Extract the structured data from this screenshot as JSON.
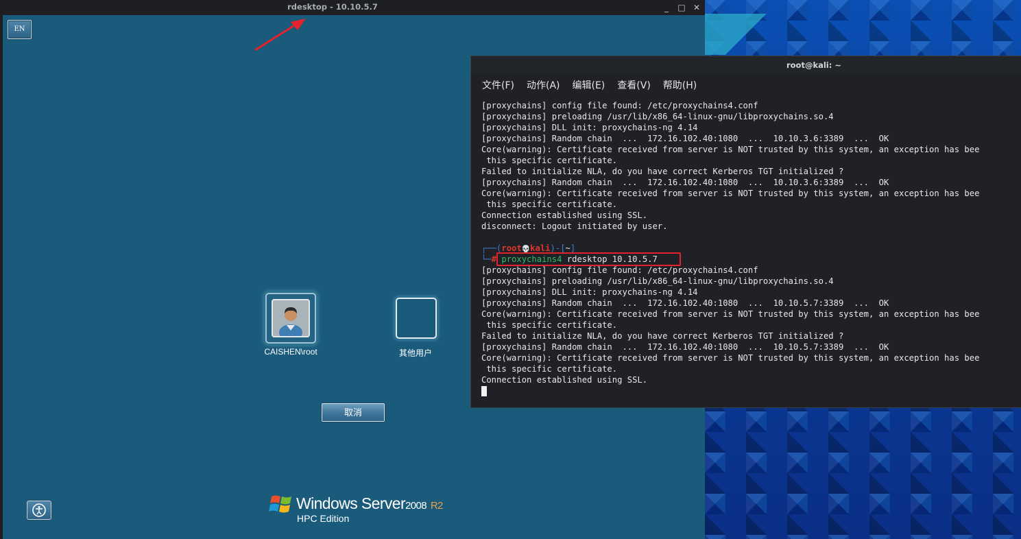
{
  "rdesktop": {
    "title": "rdesktop - 10.10.5.7",
    "controls": {
      "minimize": "_",
      "maximize": "□",
      "close": "✕"
    },
    "screen": {
      "language_badge": "EN",
      "users": [
        {
          "label": "CAISHEN\\root"
        },
        {
          "label": "其他用户"
        }
      ],
      "cancel_label": "取消",
      "branding": {
        "name": "Windows Server",
        "version": "2008",
        "release": "R2",
        "edition": "HPC Edition"
      }
    }
  },
  "terminal": {
    "title": "root@kali: ~",
    "menu": [
      "文件(F)",
      "动作(A)",
      "编辑(E)",
      "查看(V)",
      "帮助(H)"
    ],
    "lines_before": [
      "[proxychains] config file found: /etc/proxychains4.conf",
      "[proxychains] preloading /usr/lib/x86_64-linux-gnu/libproxychains.so.4",
      "[proxychains] DLL init: proxychains-ng 4.14",
      "[proxychains] Random chain  ...  172.16.102.40:1080  ...  10.10.3.6:3389  ...  OK",
      "Core(warning): Certificate received from server is NOT trusted by this system, an exception has bee",
      " this specific certificate.",
      "Failed to initialize NLA, do you have correct Kerberos TGT initialized ?",
      "[proxychains] Random chain  ...  172.16.102.40:1080  ...  10.10.3.6:3389  ...  OK",
      "Core(warning): Certificate received from server is NOT trusted by this system, an exception has bee",
      " this specific certificate.",
      "Connection established using SSL.",
      "disconnect: Logout initiated by user.",
      ""
    ],
    "prompt": {
      "frame_top": "┌──(",
      "user": "root",
      "skull": "💀",
      "host": "kali",
      "dir_open": ")-[",
      "dir": "~",
      "dir_close": "]",
      "frame_bottom": "└─",
      "symbol": "#",
      "command_name": "proxychains4",
      "command_args": " rdesktop 10.10.5.7"
    },
    "lines_after": [
      "[proxychains] config file found: /etc/proxychains4.conf",
      "[proxychains] preloading /usr/lib/x86_64-linux-gnu/libproxychains.so.4",
      "[proxychains] DLL init: proxychains-ng 4.14",
      "[proxychains] Random chain  ...  172.16.102.40:1080  ...  10.10.5.7:3389  ...  OK",
      "Core(warning): Certificate received from server is NOT trusted by this system, an exception has bee",
      " this specific certificate.",
      "Failed to initialize NLA, do you have correct Kerberos TGT initialized ?",
      "[proxychains] Random chain  ...  172.16.102.40:1080  ...  10.10.5.7:3389  ...  OK",
      "Core(warning): Certificate received from server is NOT trusted by this system, an exception has bee",
      " this specific certificate.",
      "Connection established using SSL."
    ]
  },
  "colors": {
    "login_background": "#1a5b7c",
    "annotation_red": "#e5222b",
    "prompt_red": "#e0352b",
    "prompt_blue": "#3e7bd3",
    "command_green": "#2fbf6a"
  }
}
